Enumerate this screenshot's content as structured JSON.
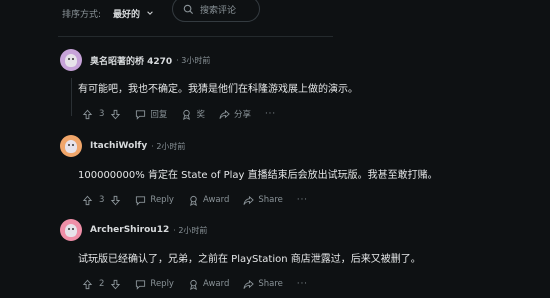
{
  "sort": {
    "label": "排序方式:",
    "value": "最好的"
  },
  "search": {
    "placeholder": "搜索评论"
  },
  "comments": [
    {
      "author": "臭名昭著的桥 4270",
      "time": "3小时前",
      "text": "有可能吧，我也不确定。我猜是他们在科隆游戏展上做的演示。",
      "votes": "3",
      "reply": "回复",
      "award": "奖",
      "share": "分享",
      "more": "···",
      "avatar_bg": "#c7a3d9"
    },
    {
      "author": "ItachiWolfy",
      "time": "2小时前",
      "text": "100000000% 肯定在 State of Play 直播结束后会放出试玩版。我甚至敢打赌。",
      "votes": "3",
      "reply": "Reply",
      "award": "Award",
      "share": "Share",
      "more": "···",
      "avatar_bg": "#f0a66a"
    },
    {
      "author": "ArcherShirou12",
      "time": "2小时前",
      "text": "试玩版已经确认了，兄弟，之前在 PlayStation 商店泄露过，后来又被删了。",
      "votes": "2",
      "reply": "Reply",
      "award": "Award",
      "share": "Share",
      "more": "···",
      "avatar_bg": "#ef8fa8"
    }
  ]
}
